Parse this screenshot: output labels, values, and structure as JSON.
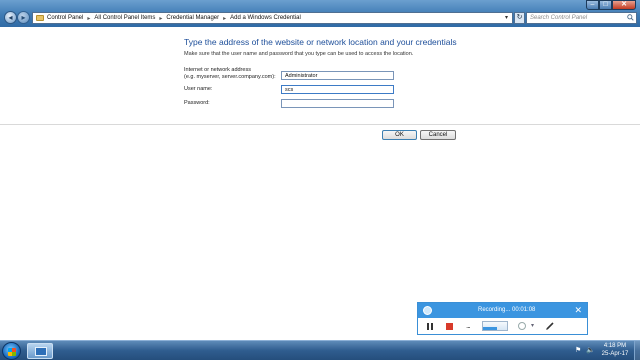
{
  "address_bar": {
    "breadcrumbs": [
      "Control Panel",
      "All Control Panel Items",
      "Credential Manager",
      "Add a Windows Credential"
    ],
    "separator": "▸",
    "search_placeholder": "Search Control Panel"
  },
  "window_controls": {
    "minimize": "–",
    "maximize": "□",
    "close": "✕"
  },
  "form": {
    "heading": "Type the address of the website or network location and your credentials",
    "instruction": "Make sure that the user name and password that you type can be used to access the location.",
    "address_label_line1": "Internet or network address",
    "address_label_line2": "(e.g. myserver, server.company.com):",
    "address_value": "Administrator",
    "username_label": "User name:",
    "username_value": "scs",
    "password_label": "Password:",
    "password_value": "",
    "ok_label": "OK",
    "cancel_label": "Cancel"
  },
  "recorder": {
    "status": "Recording... 00:01:08",
    "close_glyph": "✕",
    "more_glyph": "...",
    "level": 0.6,
    "accent": "#3b95e0"
  },
  "taskbar": {
    "time": "4:18 PM",
    "date": "25-Apr-17"
  },
  "icons": {
    "back": "back-arrow-icon",
    "forward": "forward-arrow-icon",
    "refresh": "refresh-icon",
    "search": "search-icon",
    "start": "windows-start-icon"
  }
}
